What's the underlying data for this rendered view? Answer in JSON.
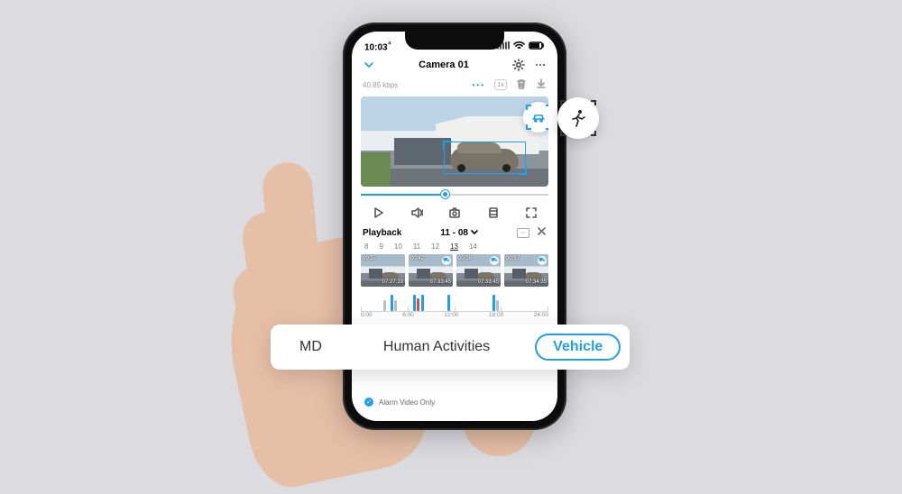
{
  "status": {
    "time": "10:03",
    "time_suffix": "⁴"
  },
  "header": {
    "title": "Camera 01",
    "back_icon": "chevron-down",
    "actions": [
      "settings-icon",
      "more-icon"
    ]
  },
  "toolbar": {
    "bitrate": "40.85 kbps",
    "speed_label": "1x"
  },
  "playback": {
    "label": "Playback",
    "date": "11 - 08",
    "day_labels": [
      "8",
      "9",
      "10",
      "11",
      "12",
      "13",
      "14"
    ],
    "today_index": 5,
    "events": [
      {
        "duration": "00:37",
        "timestamp": "07:27:19",
        "badge": null
      },
      {
        "duration": "00:42",
        "timestamp": "07:33:45",
        "badge": "vehicle"
      },
      {
        "duration": "00:38",
        "timestamp": "07:33:45",
        "badge": "vehicle"
      },
      {
        "duration": "00:37",
        "timestamp": "07:34:35",
        "badge": "vehicle"
      }
    ],
    "timeline_labels": [
      "0:00",
      "6:00",
      "12:00",
      "18:00",
      "24:00"
    ],
    "clips": [
      {
        "pos": 12,
        "type": "gray"
      },
      {
        "pos": 16,
        "type": "blue"
      },
      {
        "pos": 18,
        "type": "gray"
      },
      {
        "pos": 28,
        "type": "blue"
      },
      {
        "pos": 30,
        "type": "red"
      },
      {
        "pos": 32,
        "type": "blue"
      },
      {
        "pos": 46,
        "type": "blue"
      },
      {
        "pos": 70,
        "type": "blue"
      },
      {
        "pos": 72,
        "type": "gray"
      }
    ]
  },
  "detection": {
    "video_overlay_icon": "vehicle",
    "float_overlay_icon": "human-running"
  },
  "filters": {
    "items": [
      {
        "key": "md",
        "label": "MD",
        "active": false
      },
      {
        "key": "human",
        "label": "Human Activities",
        "active": false
      },
      {
        "key": "vehicle",
        "label": "Vehicle",
        "active": true
      }
    ]
  },
  "footer": {
    "alarm_only_label": "Alarm Video Only",
    "alarm_only_checked": true
  },
  "colors": {
    "accent": "#1ea0e6",
    "bg": "#dbdbe0"
  }
}
